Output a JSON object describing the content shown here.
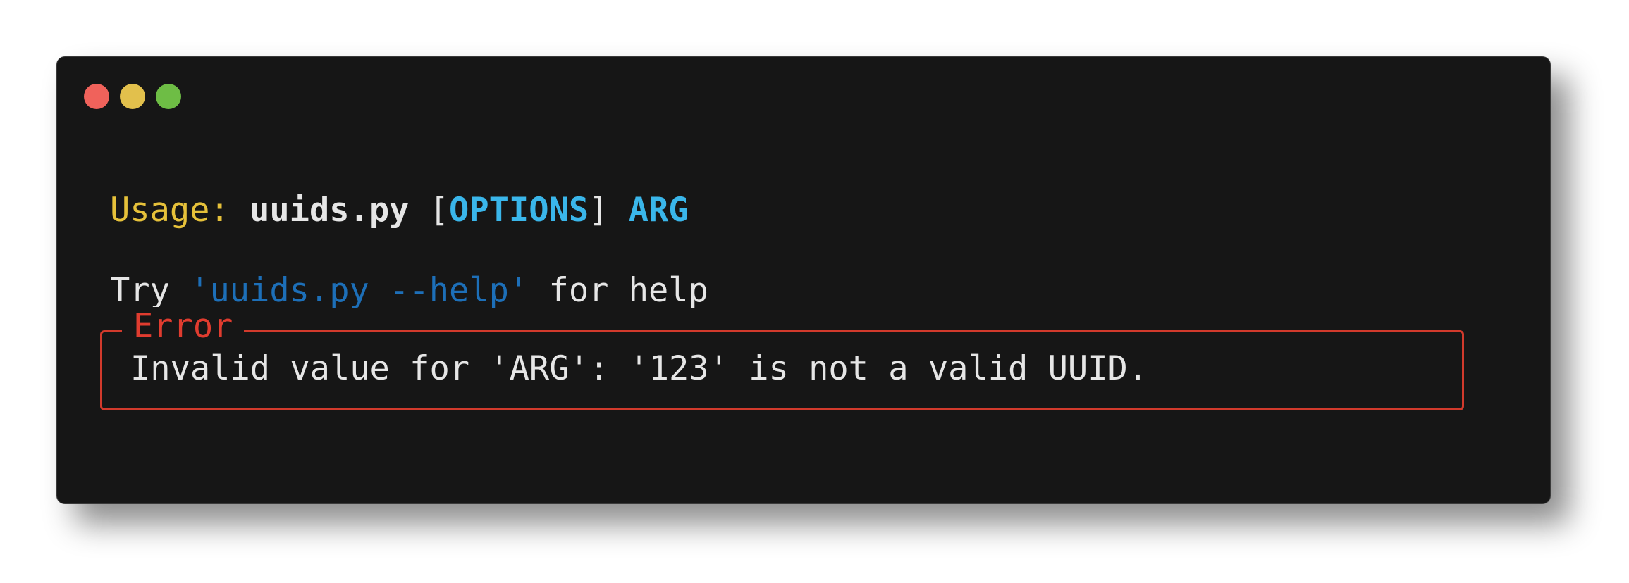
{
  "window": {
    "controls": [
      {
        "name": "close",
        "color": "#f0625b"
      },
      {
        "name": "minimize",
        "color": "#e2c04c"
      },
      {
        "name": "maximize",
        "color": "#6ebd45"
      }
    ]
  },
  "usage": {
    "label": "Usage:",
    "space1": " ",
    "program": "uuids.py",
    "space2": " ",
    "open_bracket": "[",
    "options": "OPTIONS",
    "close_bracket": "]",
    "space3": " ",
    "arg": "ARG"
  },
  "hint": {
    "prefix": "Try ",
    "command": "'uuids.py --help'",
    "suffix": " for help"
  },
  "error": {
    "title": "Error",
    "message": "Invalid value for 'ARG': '123' is not a valid UUID."
  },
  "colors": {
    "background": "#161616",
    "usage_label": "#e6c13a",
    "options": "#3ab6ea",
    "hint_command": "#1d6fb8",
    "error_border": "#d23a2c",
    "error_title": "#e03c2f"
  }
}
